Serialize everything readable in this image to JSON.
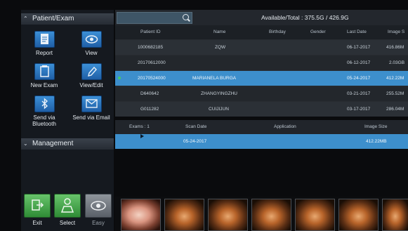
{
  "sidebar": {
    "patient_exam_title": "Patient/Exam",
    "management_title": "Management",
    "tools": [
      {
        "label": "Report",
        "icon": "report-icon"
      },
      {
        "label": "View",
        "icon": "eye-icon"
      },
      {
        "label": "New Exam",
        "icon": "new-exam-icon"
      },
      {
        "label": "View/Edit",
        "icon": "pencil-icon"
      },
      {
        "label": "Send via Bluetooth",
        "icon": "bluetooth-icon"
      },
      {
        "label": "Send via Email",
        "icon": "envelope-icon"
      }
    ],
    "bottom_buttons": [
      {
        "label": "Exit",
        "icon": "exit-icon"
      },
      {
        "label": "Select",
        "icon": "select-icon"
      },
      {
        "label": "Easy",
        "icon": "eye-icon"
      }
    ]
  },
  "topbar": {
    "search_placeholder": "",
    "storage_text": "Available/Total : 375.5G / 426.9G"
  },
  "patient_table": {
    "columns": [
      "Patient ID",
      "Name",
      "Birthday",
      "Gender",
      "Last Date",
      "Image S"
    ],
    "rows": [
      {
        "id": "1000682185",
        "name": "ZQW",
        "birthday": "",
        "gender": "",
        "last_date": "06-17-2017",
        "image_size": "416.86M"
      },
      {
        "id": "20170612000",
        "name": "",
        "birthday": "",
        "gender": "",
        "last_date": "06-12-2017",
        "image_size": "2.03GB"
      },
      {
        "id": "20170524000",
        "name": "MARIANELA  BURGA",
        "birthday": "",
        "gender": "",
        "last_date": "05-24-2017",
        "image_size": "412.22M"
      },
      {
        "id": "D640642",
        "name": "ZHANGYINGZHU",
        "birthday": "",
        "gender": "",
        "last_date": "03-21-2017",
        "image_size": "255.52M"
      },
      {
        "id": "G011282",
        "name": "CUIJIJUN",
        "birthday": "",
        "gender": "",
        "last_date": "03-17-2017",
        "image_size": "286.04M"
      }
    ],
    "selected_index": 2
  },
  "exam_table": {
    "exams_label": "Exams : 1",
    "columns": [
      "Scan Date",
      "Application",
      "Image Size"
    ],
    "rows": [
      {
        "scan_date": "05-24-2017",
        "application": "",
        "image_size": "412.22MB"
      }
    ]
  },
  "filmstrip": {
    "thumbnail_count": 7
  },
  "colors": {
    "accent": "#3d8fcc",
    "tool_icon_blue": "#2f7cc4",
    "green_button": "#4caf50"
  }
}
